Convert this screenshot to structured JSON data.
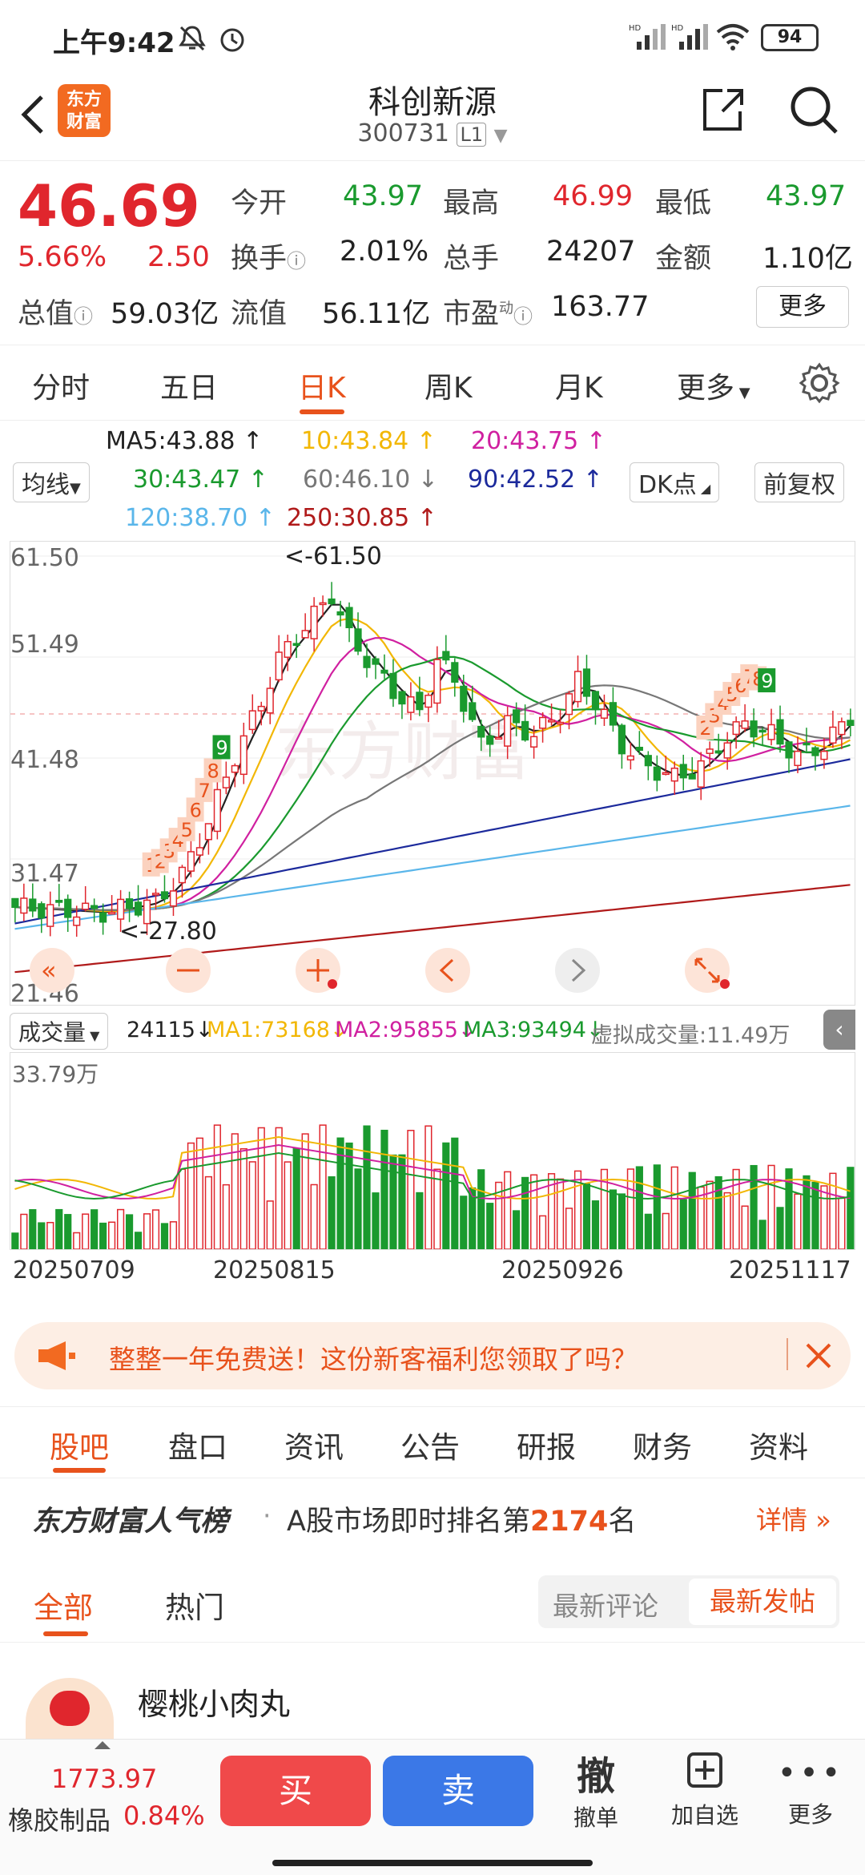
{
  "status_bar": {
    "time": "上午9:42",
    "battery": "94"
  },
  "nav": {
    "title": "科创新源",
    "code": "300731",
    "level": "L1",
    "logo_line1": "东方",
    "logo_line2": "财富"
  },
  "quote": {
    "price": "46.69",
    "change_pct": "5.66%",
    "change": "2.50",
    "open_label": "今开",
    "open": "43.97",
    "high_label": "最高",
    "high": "46.99",
    "low_label": "最低",
    "low": "43.97",
    "turnover_label": "换手",
    "turnover": "2.01%",
    "volume_label": "总手",
    "volume": "24207",
    "amount_label": "金额",
    "amount": "1.10亿",
    "mcap_label": "总值",
    "mcap": "59.03亿",
    "float_label": "流值",
    "float_cap": "56.11亿",
    "pe_label": "市盈",
    "pe_sup": "动",
    "pe": "163.77",
    "more": "更多"
  },
  "chart_tabs": [
    {
      "label": "分时"
    },
    {
      "label": "五日"
    },
    {
      "label": "日K"
    },
    {
      "label": "周K"
    },
    {
      "label": "月K"
    },
    {
      "label": "更多"
    }
  ],
  "ma": {
    "selector": "均线",
    "ma5": "MA5:43.88 ↑",
    "ma10": "10:43.84 ↑",
    "ma20": "20:43.75 ↑",
    "ma30": "30:43.47 ↑",
    "ma60": "60:46.10 ↓",
    "ma90": "90:42.52 ↑",
    "ma120": "120:38.70 ↑",
    "ma250": "250:30.85 ↑",
    "dk": "DK点",
    "adjust": "前复权"
  },
  "price_axis": [
    "61.50",
    "51.49",
    "41.48",
    "31.47",
    "21.46"
  ],
  "annotations": {
    "high": "<-61.50",
    "low": "<-27.80",
    "watermark": "东方财富"
  },
  "markers": [
    "1",
    "2",
    "3",
    "4",
    "5",
    "6",
    "7",
    "8",
    "9",
    "2",
    "3",
    "4",
    "5",
    "6",
    "7",
    "8",
    "9"
  ],
  "volume": {
    "selector": "成交量",
    "current": "24115↓",
    "ma1": "MA1:73168↓",
    "ma2": "MA2:95855↓",
    "ma3": "MA3:93494↓",
    "virtual": "虚拟成交量:11.49万",
    "axis_max": "33.79万"
  },
  "dates": [
    "20250709",
    "20250815",
    "20250926",
    "20251117"
  ],
  "colors": {
    "up": "#e0262d",
    "down": "#1a9a2e",
    "ma5": "#222222",
    "ma10": "#f2b705",
    "ma20": "#d020a0",
    "ma30": "#1a9a2e",
    "ma60": "#777777",
    "ma90": "#1c2a9c",
    "ma120": "#5ab6ea",
    "ma250": "#b01a1a",
    "accent": "#e8521c"
  },
  "banner": {
    "text": "整整一年免费送！这份新客福利您领取了吗？"
  },
  "sub_tabs": [
    {
      "label": "股吧"
    },
    {
      "label": "盘口"
    },
    {
      "label": "资讯"
    },
    {
      "label": "公告"
    },
    {
      "label": "研报"
    },
    {
      "label": "财务"
    },
    {
      "label": "资料"
    }
  ],
  "rank": {
    "brand": "东方财富人气榜",
    "text_prefix": "A股市场即时排名第",
    "rank_no": "2174",
    "text_suffix": "名",
    "detail": "详情"
  },
  "filter": {
    "all": "全部",
    "hot": "热门",
    "latest_comment": "最新评论",
    "latest_post": "最新发帖"
  },
  "post": {
    "author": "樱桃小肉丸"
  },
  "bottom": {
    "index_value": "1773.97",
    "index_name": "橡胶制品",
    "index_pct": "0.84%",
    "buy": "买",
    "sell": "卖",
    "cancel_big": "撤",
    "cancel": "撤单",
    "add_watch": "加自选",
    "more": "更多"
  }
}
